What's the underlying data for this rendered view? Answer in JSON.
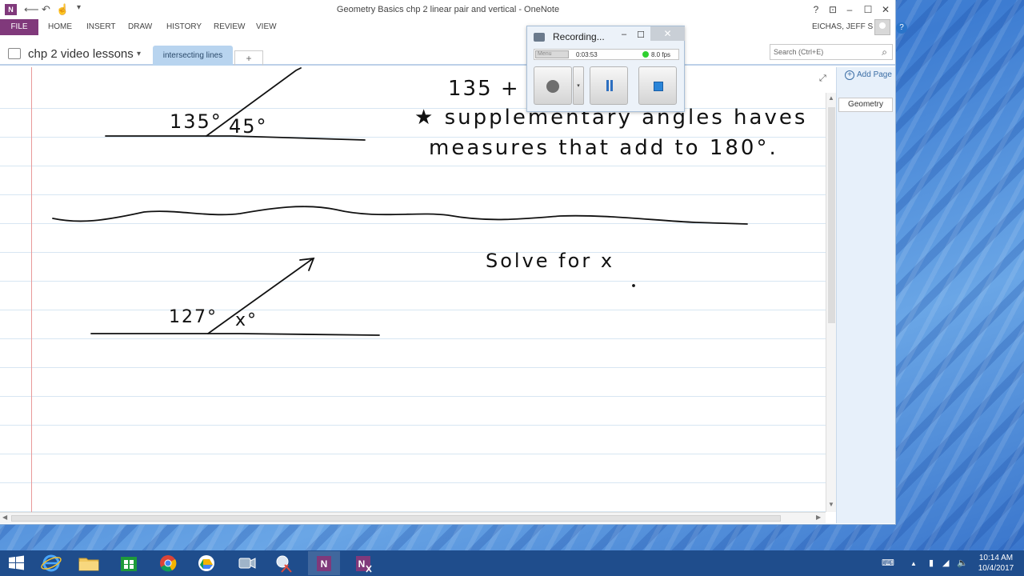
{
  "window": {
    "title": "Geometry Basics chp 2 linear pair and vertical - OneNote",
    "app_icon": "N",
    "qat_icons": [
      "back-icon",
      "undo-icon",
      "touch-mode-icon",
      "customize-icon"
    ],
    "controls": {
      "help": "?",
      "restore_ribbon": "⊡",
      "minimize": "–",
      "maximize": "☐",
      "close": "✕"
    }
  },
  "ribbon": {
    "file": "FILE",
    "tabs": [
      "HOME",
      "INSERT",
      "DRAW",
      "HISTORY",
      "REVIEW",
      "VIEW"
    ],
    "user": "EICHAS, JEFF S ▾",
    "help": "?"
  },
  "notebook": {
    "name": "chp 2 video lessons",
    "caret": "▾",
    "section_tab": "intersecting lines",
    "add_tab": "+",
    "search_placeholder": "Search (Ctrl+E)",
    "search_icon": "⌕"
  },
  "pages": {
    "add_page": "Add Page",
    "add_plus": "+",
    "list": [
      "Geometry"
    ]
  },
  "notes": {
    "angle_135": "135°",
    "angle_45": "45°",
    "sum_partial": "135 + 45",
    "supplementary_line1": "★ supplementary  angles  haves",
    "supplementary_line2": "measures  that  add  to  180°.",
    "solve_for": "Solve  for  x",
    "angle_127": "127°",
    "angle_x": "x°"
  },
  "recorder": {
    "title": "Recording...",
    "minimize": "–",
    "maximize": "☐",
    "close": "✕",
    "menu": "Menu",
    "time": "0:03:53",
    "fps": "8.0 fps",
    "fps_color": "#2fd02f",
    "dropdown_arrow": "▾"
  },
  "taskbar": {
    "apps": [
      "start-icon",
      "internet-explorer-icon",
      "file-explorer-icon",
      "store-icon",
      "chrome-icon",
      "google-drive-icon",
      "screen-recorder-icon",
      "snipping-tool-icon",
      "onenote-icon",
      "onenote-clipper-icon"
    ],
    "time": "10:14 AM",
    "date": "10/4/2017",
    "tray": [
      "keyboard-icon",
      "show-hidden-icon",
      "battery-icon",
      "network-icon",
      "volume-icon"
    ]
  },
  "colors": {
    "onenote_purple": "#80397b",
    "section_tab": "#b8d4ef",
    "taskbar": "#1f4d8c",
    "margin_line": "#e89a9a"
  }
}
